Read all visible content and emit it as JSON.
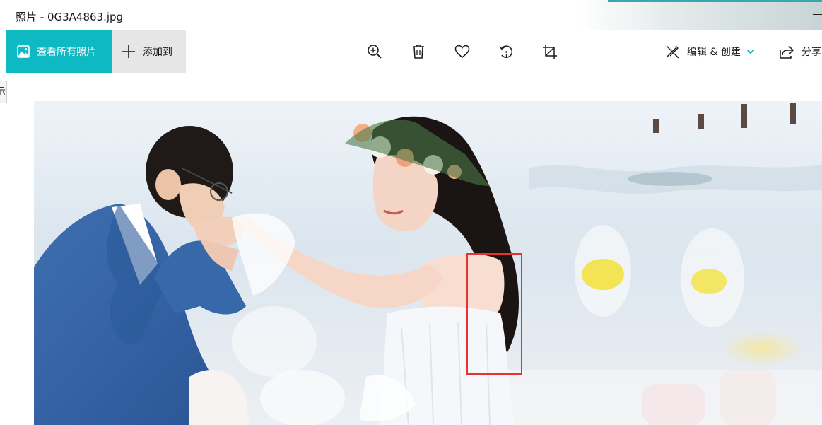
{
  "window": {
    "title": "照片 - 0G3A4863.jpg"
  },
  "toolbar": {
    "view_all_label": "查看所有照片",
    "add_to_label": "添加到",
    "edit_create_label": "编辑 & 创建",
    "share_label": "分享"
  },
  "left_fragment": {
    "text": "示"
  },
  "icons": {
    "view_all": "photos-icon",
    "add": "plus-icon",
    "zoom": "zoom-in-icon",
    "delete": "trash-icon",
    "favorite": "heart-icon",
    "rotate": "rotate-icon",
    "crop": "crop-icon",
    "edit": "edit-create-icon",
    "chevron": "chevron-down-icon",
    "share": "share-icon"
  },
  "colors": {
    "accent": "#0fb9c3",
    "add_button_bg": "#e6e6e6",
    "annotation": "#e53333"
  }
}
